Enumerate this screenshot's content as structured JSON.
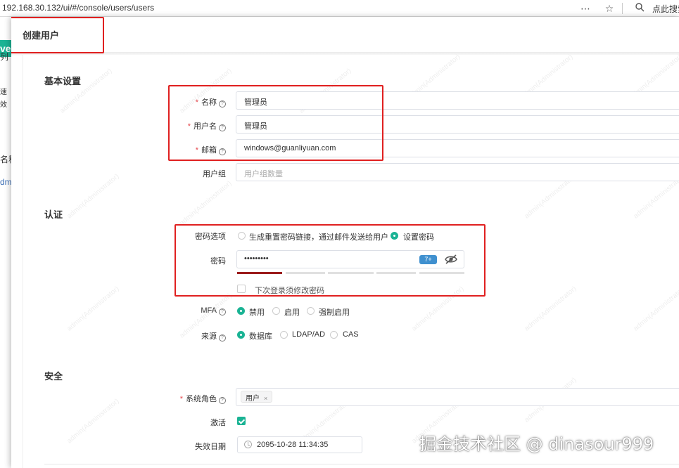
{
  "browser": {
    "url": "192.168.30.132/ui/#/console/users/users",
    "search_label": "点此搜索"
  },
  "background_app": {
    "logo_fragment": "ve",
    "fragments": [
      "列",
      "速",
      "效",
      "名称",
      "dm"
    ]
  },
  "drawer": {
    "title": "创建用户"
  },
  "sections": {
    "basic": "基本设置",
    "auth": "认证",
    "security": "安全"
  },
  "form": {
    "name": {
      "label": "名称",
      "value": "管理员"
    },
    "username": {
      "label": "用户名",
      "value": "管理员"
    },
    "email": {
      "label": "邮箱",
      "value": "windows@guanliyuan.com"
    },
    "groups": {
      "label": "用户组",
      "placeholder": "用户组数量"
    },
    "password_option": {
      "label": "密码选项",
      "options": [
        "生成重置密码链接，通过邮件发送给用户",
        "设置密码"
      ],
      "selected": "设置密码"
    },
    "password": {
      "label": "密码",
      "masked_value": "•••••••••",
      "badge": "7+",
      "strength_level": 1,
      "strength_total": 5
    },
    "must_change": {
      "label": "下次登录须修改密码",
      "checked": false
    },
    "mfa": {
      "label": "MFA",
      "options": [
        "禁用",
        "启用",
        "强制启用"
      ],
      "selected": "禁用"
    },
    "source": {
      "label": "来源",
      "options": [
        "数据库",
        "LDAP/AD",
        "CAS"
      ],
      "selected": "数据库"
    },
    "system_role": {
      "label": "系统角色",
      "tag": "用户",
      "tag_close": "×"
    },
    "active": {
      "label": "激活",
      "checked": true
    },
    "expire": {
      "label": "失效日期",
      "value": "2095-10-28 11:34:35"
    }
  },
  "watermark": {
    "text": "admin(Administrator)",
    "site": "掘金技术社区 @ dinasour999"
  },
  "colors": {
    "accent": "#1ab394",
    "required": "#e5494e",
    "highlight": "#e02020",
    "strength": "#9b1c1c",
    "badge": "#3f90cf"
  }
}
